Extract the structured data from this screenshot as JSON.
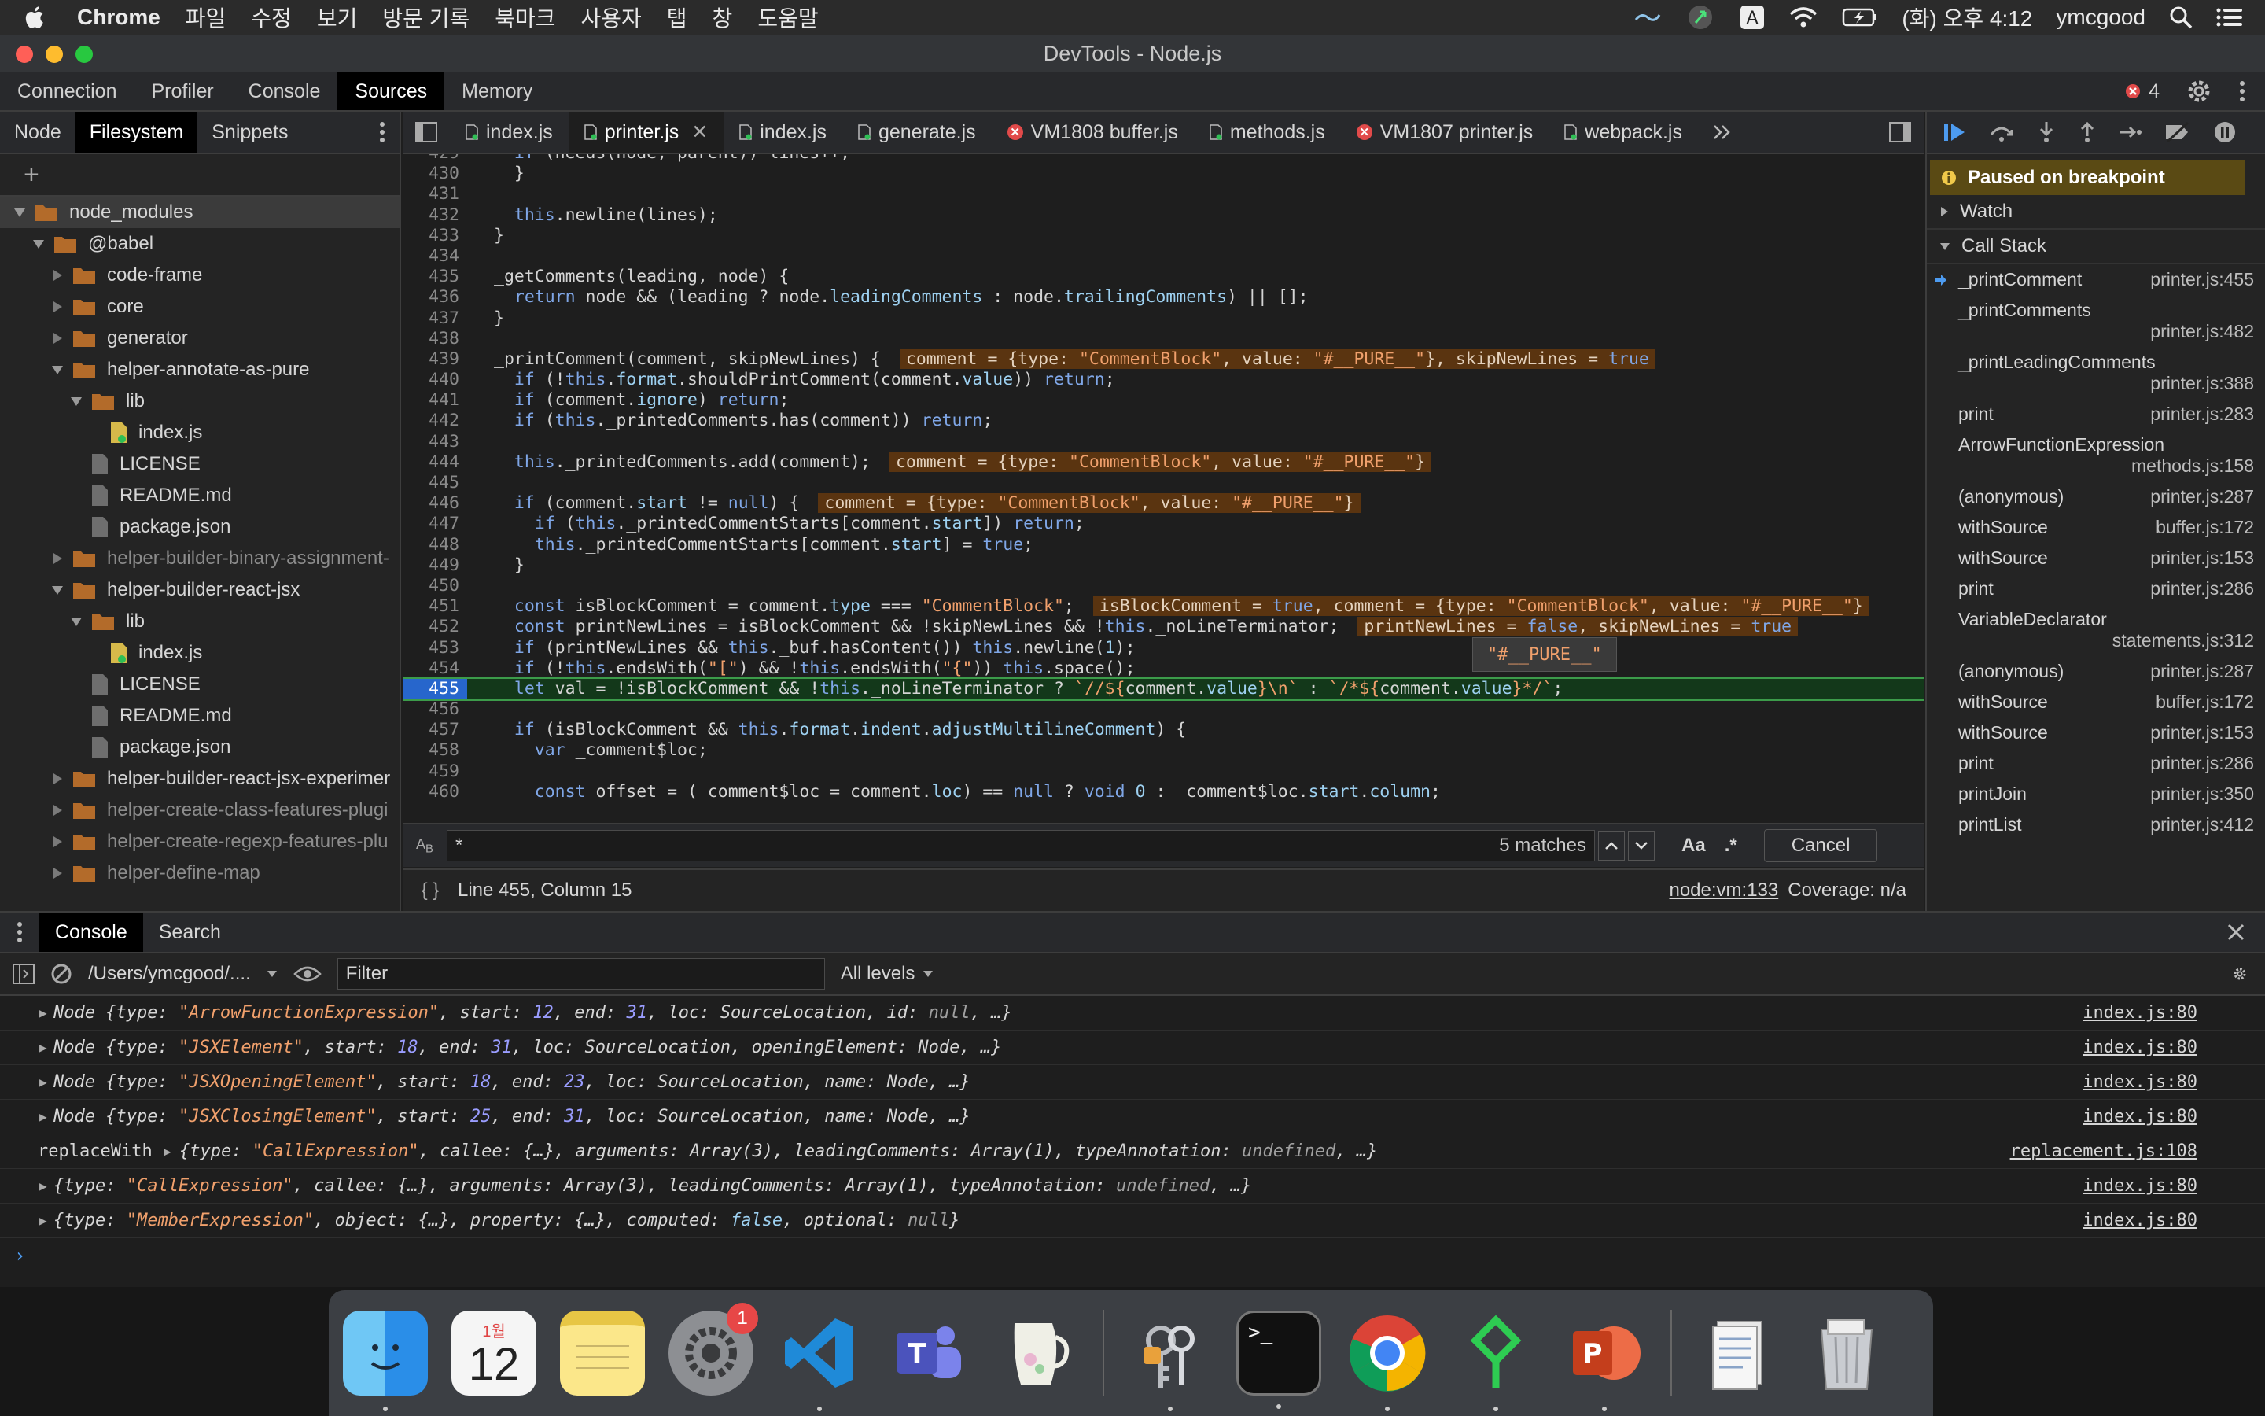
{
  "menubar": {
    "app": "Chrome",
    "items": [
      "파일",
      "수정",
      "보기",
      "방문 기록",
      "북마크",
      "사용자",
      "탭",
      "창",
      "도움말"
    ],
    "clock": "(화) 오후 4:12",
    "user": "ymcgood"
  },
  "window": {
    "title": "DevTools - Node.js"
  },
  "panel_tabs": [
    "Connection",
    "Profiler",
    "Console",
    "Sources",
    "Memory"
  ],
  "error_count": "4",
  "navigator": {
    "tabs": [
      "Node",
      "Filesystem",
      "Snippets"
    ],
    "tree": [
      {
        "label": "node_modules",
        "kind": "folder",
        "open": true,
        "depth": 0,
        "selected": true
      },
      {
        "label": "@babel",
        "kind": "folder",
        "open": true,
        "depth": 1
      },
      {
        "label": "code-frame",
        "kind": "folder",
        "open": false,
        "depth": 2
      },
      {
        "label": "core",
        "kind": "folder",
        "open": false,
        "depth": 2
      },
      {
        "label": "generator",
        "kind": "folder",
        "open": false,
        "depth": 2
      },
      {
        "label": "helper-annotate-as-pure",
        "kind": "folder",
        "open": true,
        "depth": 2
      },
      {
        "label": "lib",
        "kind": "folder",
        "open": true,
        "depth": 3
      },
      {
        "label": "index.js",
        "kind": "jsfile",
        "depth": 4
      },
      {
        "label": "LICENSE",
        "kind": "file",
        "depth": 3
      },
      {
        "label": "README.md",
        "kind": "file",
        "depth": 3
      },
      {
        "label": "package.json",
        "kind": "file",
        "depth": 3
      },
      {
        "label": "helper-builder-binary-assignment-",
        "kind": "folder",
        "open": false,
        "depth": 2,
        "dim": true
      },
      {
        "label": "helper-builder-react-jsx",
        "kind": "folder",
        "open": true,
        "depth": 2
      },
      {
        "label": "lib",
        "kind": "folder",
        "open": true,
        "depth": 3
      },
      {
        "label": "index.js",
        "kind": "jsfile",
        "depth": 4
      },
      {
        "label": "LICENSE",
        "kind": "file",
        "depth": 3
      },
      {
        "label": "README.md",
        "kind": "file",
        "depth": 3
      },
      {
        "label": "package.json",
        "kind": "file",
        "depth": 3
      },
      {
        "label": "helper-builder-react-jsx-experimer",
        "kind": "folder",
        "open": false,
        "depth": 2
      },
      {
        "label": "helper-create-class-features-plugi",
        "kind": "folder",
        "open": false,
        "depth": 2,
        "dim": true
      },
      {
        "label": "helper-create-regexp-features-plu",
        "kind": "folder",
        "open": false,
        "depth": 2,
        "dim": true
      },
      {
        "label": "helper-define-map",
        "kind": "folder",
        "open": false,
        "depth": 2,
        "dim": true
      }
    ]
  },
  "editor": {
    "tabs": [
      {
        "label": "index.js",
        "err": false,
        "active": false
      },
      {
        "label": "printer.js",
        "err": false,
        "active": true
      },
      {
        "label": "index.js",
        "err": false,
        "active": false
      },
      {
        "label": "generate.js",
        "err": false,
        "active": false
      },
      {
        "label": "VM1808 buffer.js",
        "err": true,
        "active": false
      },
      {
        "label": "methods.js",
        "err": false,
        "active": false
      },
      {
        "label": "VM1807 printer.js",
        "err": true,
        "active": false
      },
      {
        "label": "webpack.js",
        "err": false,
        "active": false
      }
    ],
    "tooltip": "\"#__PURE__\"",
    "search": {
      "query": "*",
      "matches": "5 matches",
      "case_label": "Aa",
      "regex_label": ".*",
      "cancel": "Cancel"
    },
    "status": {
      "position": "Line 455, Column 15",
      "source_link": "node:vm:133",
      "coverage": "Coverage: n/a"
    }
  },
  "debugger": {
    "paused": "Paused on breakpoint",
    "watch": "Watch",
    "call_stack": "Call Stack",
    "frames": [
      {
        "name": "_printComment",
        "loc": "printer.js:455",
        "current": true,
        "twoline": false
      },
      {
        "name": "_printComments",
        "loc": "printer.js:482",
        "twoline": true
      },
      {
        "name": "_printLeadingComments",
        "loc": "printer.js:388",
        "twoline": true
      },
      {
        "name": "print",
        "loc": "printer.js:283",
        "twoline": false
      },
      {
        "name": "ArrowFunctionExpression",
        "loc": "methods.js:158",
        "twoline": true
      },
      {
        "name": "(anonymous)",
        "loc": "printer.js:287",
        "twoline": false
      },
      {
        "name": "withSource",
        "loc": "buffer.js:172",
        "twoline": false
      },
      {
        "name": "withSource",
        "loc": "printer.js:153",
        "twoline": false
      },
      {
        "name": "print",
        "loc": "printer.js:286",
        "twoline": false
      },
      {
        "name": "VariableDeclarator",
        "loc": "statements.js:312",
        "twoline": true
      },
      {
        "name": "(anonymous)",
        "loc": "printer.js:287",
        "twoline": false
      },
      {
        "name": "withSource",
        "loc": "buffer.js:172",
        "twoline": false
      },
      {
        "name": "withSource",
        "loc": "printer.js:153",
        "twoline": false
      },
      {
        "name": "print",
        "loc": "printer.js:286",
        "twoline": false
      },
      {
        "name": "printJoin",
        "loc": "printer.js:350",
        "twoline": false
      },
      {
        "name": "printList",
        "loc": "printer.js:412",
        "twoline": false
      }
    ]
  },
  "drawer": {
    "tabs": [
      "Console",
      "Search"
    ],
    "context": "/Users/ymcgood/....",
    "filter_placeholder": "Filter",
    "levels": "All levels"
  },
  "console_rows": [
    {
      "prefix": "",
      "expand": true,
      "src": "index.js:80"
    },
    {
      "prefix": "",
      "expand": true,
      "src": "index.js:80"
    },
    {
      "prefix": "",
      "expand": true,
      "src": "index.js:80"
    },
    {
      "prefix": "",
      "expand": true,
      "src": "index.js:80"
    },
    {
      "prefix": "replaceWith",
      "expand": true,
      "src": "replacement.js:108"
    },
    {
      "prefix": "",
      "expand": true,
      "src": "index.js:80"
    },
    {
      "prefix": "",
      "expand": true,
      "src": "index.js:80"
    }
  ],
  "dock": {
    "calendar_month": "1월",
    "calendar_day": "12",
    "prefs_badge": "1"
  }
}
